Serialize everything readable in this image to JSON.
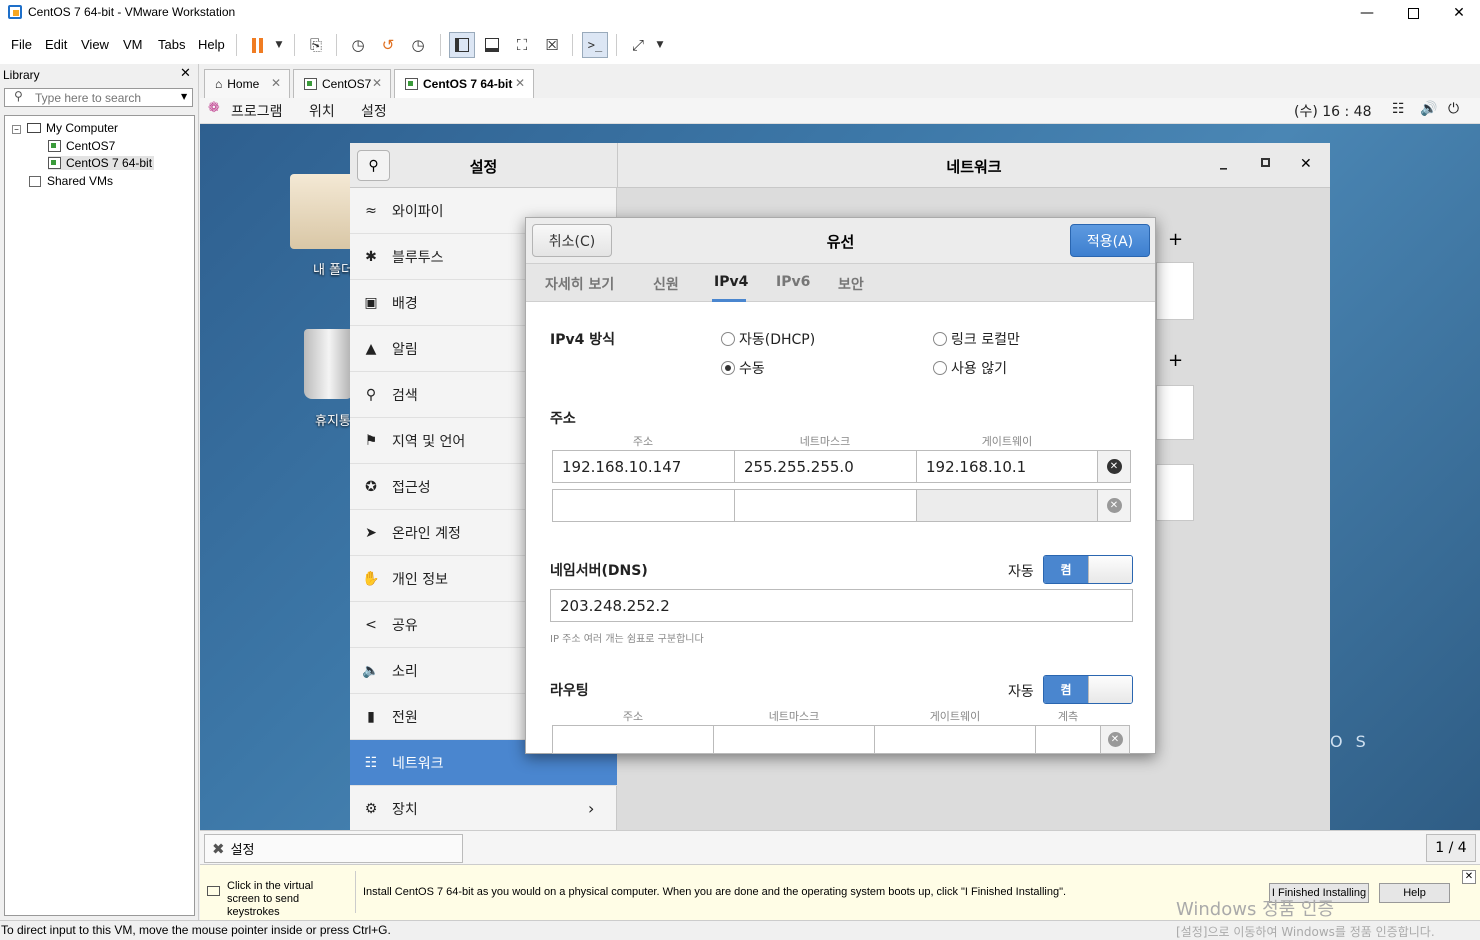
{
  "window": {
    "title": "CentOS 7 64-bit - VMware Workstation"
  },
  "menu": [
    "File",
    "Edit",
    "View",
    "VM",
    "Tabs",
    "Help"
  ],
  "library": {
    "title": "Library",
    "search_placeholder": "Type here to search",
    "tree": {
      "root": "My Computer",
      "vm1": "CentOS7",
      "vm2": "CentOS 7 64-bit",
      "shared": "Shared VMs"
    }
  },
  "tabs": [
    {
      "label": "Home"
    },
    {
      "label": "CentOS7"
    },
    {
      "label": "CentOS 7 64-bit"
    }
  ],
  "guest_topbar": {
    "apps": "프로그램",
    "places": "위치",
    "settings": "설정",
    "clock": "(수) 16 : 48"
  },
  "desktop": {
    "folder_label": "내 폴더",
    "trash_label": "휴지통",
    "watermark": "O S"
  },
  "settings": {
    "left_title": "설정",
    "right_title": "네트워크",
    "items": [
      "와이파이",
      "블루투스",
      "배경",
      "알림",
      "검색",
      "지역 및 언어",
      "접근성",
      "온라인 계정",
      "개인 정보",
      "공유",
      "소리",
      "전원",
      "네트워크",
      "장치"
    ]
  },
  "dialog": {
    "cancel": "취소(C)",
    "title": "유선",
    "apply": "적용(A)",
    "tabs": [
      "자세히 보기",
      "신원",
      "IPv4",
      "IPv6",
      "보안"
    ],
    "method_label": "IPv4 방식",
    "methods": {
      "dhcp": "자동(DHCP)",
      "link_local": "링크 로컬만",
      "manual": "수동",
      "disable": "사용 않기"
    },
    "address_label": "주소",
    "cols": {
      "address": "주소",
      "netmask": "네트마스크",
      "gateway": "게이트웨이",
      "metric": "계측"
    },
    "address": {
      "ip": "192.168.10.147",
      "netmask": "255.255.255.0",
      "gateway": "192.168.10.1"
    },
    "dns_label": "네임서버(DNS)",
    "auto_label": "자동",
    "switch_on": "켬",
    "dns_value": "203.248.252.2",
    "dns_hint": "IP 주소 여러 개는 쉼표로 구분합니다",
    "routing_label": "라우팅"
  },
  "guest_status": {
    "app": "설정",
    "pager": "1 / 4"
  },
  "hint": {
    "left": "Click in the virtual screen to send keystrokes",
    "message": "Install CentOS 7 64-bit as you would on a physical computer. When you are done and the operating system boots up, click \"I Finished Installing\".",
    "finished": "I Finished Installing",
    "help": "Help",
    "activation_title": "Windows 정품 인증",
    "activation_sub": "[설정]으로 이동하여 Windows를 정품 인증합니다."
  },
  "statusbar": {
    "text": "To direct input to this VM, move the mouse pointer inside or press Ctrl+G."
  },
  "colors": {
    "accent": "#4a86cf",
    "pause": "#f07c22"
  }
}
